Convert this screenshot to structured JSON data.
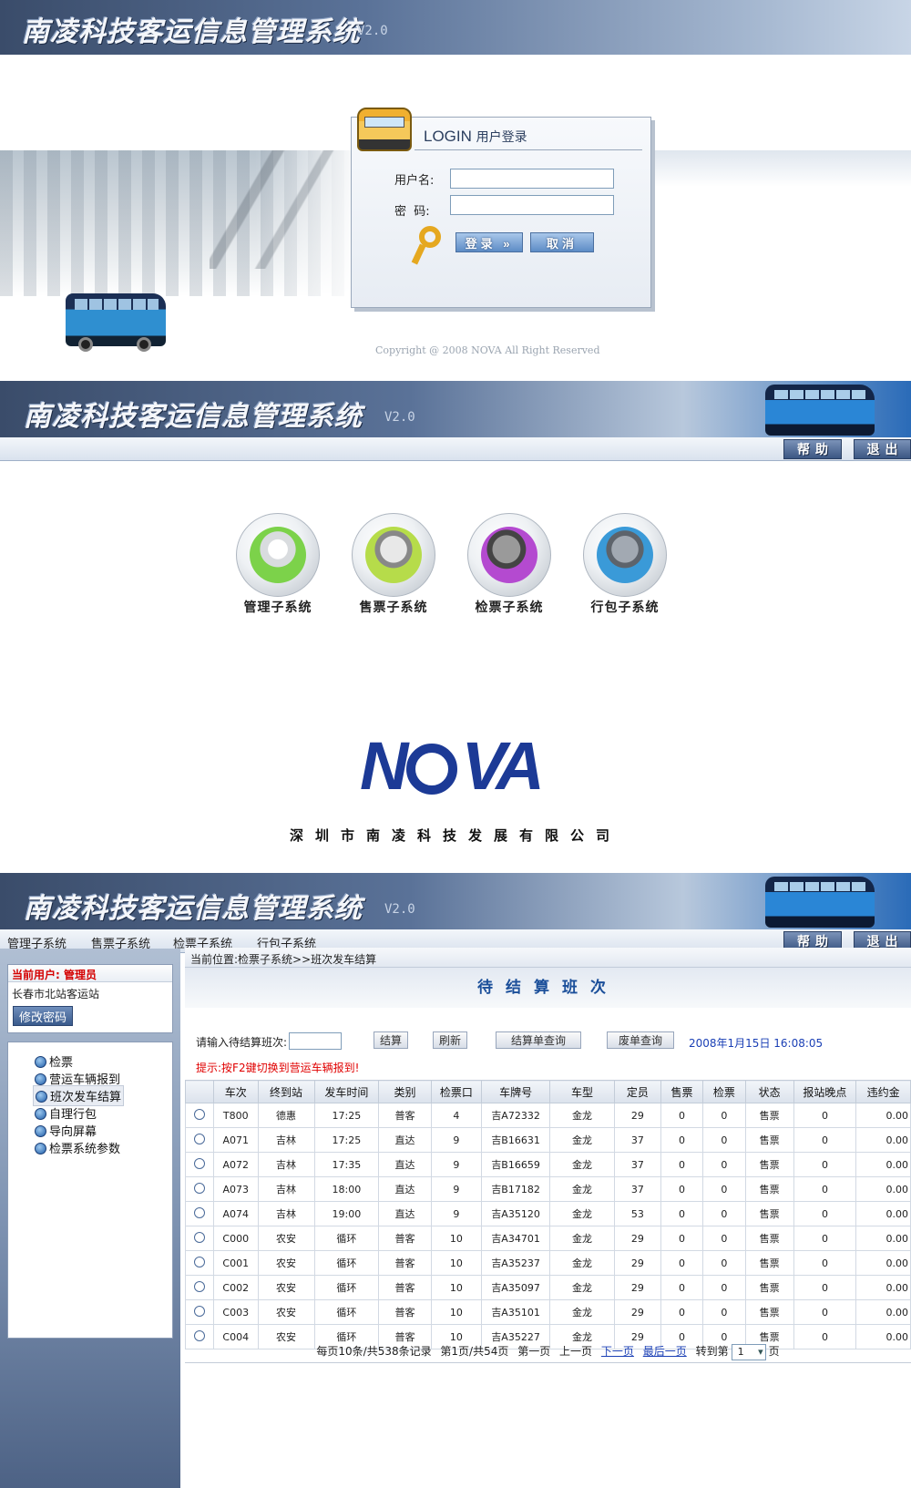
{
  "login": {
    "banner_title": "南凌科技客运信息管理系统",
    "banner_version": "V2.0",
    "box_title_en": "LOGIN",
    "box_title_cn": "用户登录",
    "username_label": "用户名:",
    "password_label": "密  码:",
    "username_value": "",
    "password_value": "",
    "login_button": "登录 »",
    "cancel_button": "取消",
    "copyright": "Copyright @ 2008 NOVA All Right Reserved"
  },
  "chooser": {
    "banner_title": "南凌科技客运信息管理系统",
    "banner_version": "V2.0",
    "help_button": "帮助",
    "exit_button": "退出",
    "subsystems": [
      {
        "label": "管理子系统",
        "icon": "people-icon",
        "color": "#7cd24a"
      },
      {
        "label": "售票子系统",
        "icon": "ticket-sell-icon",
        "color": "#b6dc4a"
      },
      {
        "label": "检票子系统",
        "icon": "ticket-check-icon",
        "color": "#b44ad0"
      },
      {
        "label": "行包子系统",
        "icon": "luggage-icon",
        "color": "#3a9ad8"
      }
    ],
    "logo_text_left": "N",
    "logo_text_right": "VA",
    "company": "深圳市南凌科技发展有限公司"
  },
  "check": {
    "banner_title": "南凌科技客运信息管理系统",
    "banner_version": "V2.0",
    "menu": [
      "管理子系统",
      "售票子系统",
      "检票子系统",
      "行包子系统"
    ],
    "help_button": "帮助",
    "exit_button": "退出",
    "user_label": "当前用户:",
    "user_name": "管理员",
    "station": "长春市北站客运站",
    "change_password": "修改密码",
    "nav": [
      "检票",
      "营运车辆报到",
      "班次发车结算",
      "自理行包",
      "导向屏幕",
      "检票系统参数"
    ],
    "nav_active": 2,
    "breadcrumb": "当前位置:检票子系统>>班次发车结算",
    "page_title": "待结算班次",
    "input_label": "请输入待结算班次:",
    "input_value": "",
    "settle_button": "结算",
    "refresh_button": "刷新",
    "settle_query_button": "结算单查询",
    "void_query_button": "废单查询",
    "datetime": "2008年1月15日 16:08:05",
    "tip": "提示:按F2键切换到营运车辆报到!",
    "columns": [
      "",
      "车次",
      "终到站",
      "发车时间",
      "类别",
      "检票口",
      "车牌号",
      "车型",
      "定员",
      "售票",
      "检票",
      "状态",
      "报站晚点",
      "违约金"
    ],
    "rows": [
      [
        "T800",
        "德惠",
        "17:25",
        "普客",
        "4",
        "吉A72332",
        "金龙",
        "29",
        "0",
        "0",
        "售票",
        "0",
        "0.00"
      ],
      [
        "A071",
        "吉林",
        "17:25",
        "直达",
        "9",
        "吉B16631",
        "金龙",
        "37",
        "0",
        "0",
        "售票",
        "0",
        "0.00"
      ],
      [
        "A072",
        "吉林",
        "17:35",
        "直达",
        "9",
        "吉B16659",
        "金龙",
        "37",
        "0",
        "0",
        "售票",
        "0",
        "0.00"
      ],
      [
        "A073",
        "吉林",
        "18:00",
        "直达",
        "9",
        "吉B17182",
        "金龙",
        "37",
        "0",
        "0",
        "售票",
        "0",
        "0.00"
      ],
      [
        "A074",
        "吉林",
        "19:00",
        "直达",
        "9",
        "吉A35120",
        "金龙",
        "53",
        "0",
        "0",
        "售票",
        "0",
        "0.00"
      ],
      [
        "C000",
        "农安",
        "循环",
        "普客",
        "10",
        "吉A34701",
        "金龙",
        "29",
        "0",
        "0",
        "售票",
        "0",
        "0.00"
      ],
      [
        "C001",
        "农安",
        "循环",
        "普客",
        "10",
        "吉A35237",
        "金龙",
        "29",
        "0",
        "0",
        "售票",
        "0",
        "0.00"
      ],
      [
        "C002",
        "农安",
        "循环",
        "普客",
        "10",
        "吉A35097",
        "金龙",
        "29",
        "0",
        "0",
        "售票",
        "0",
        "0.00"
      ],
      [
        "C003",
        "农安",
        "循环",
        "普客",
        "10",
        "吉A35101",
        "金龙",
        "29",
        "0",
        "0",
        "售票",
        "0",
        "0.00"
      ],
      [
        "C004",
        "农安",
        "循环",
        "普客",
        "10",
        "吉A35227",
        "金龙",
        "29",
        "0",
        "0",
        "售票",
        "0",
        "0.00"
      ]
    ],
    "pager": {
      "summary": "每页10条/共538条记录",
      "page_info": "第1页/共54页",
      "first": "第一页",
      "prev": "上一页",
      "next": "下一页",
      "last": "最后一页",
      "goto_prefix": "转到第",
      "goto_value": "1",
      "goto_suffix": "页"
    }
  }
}
